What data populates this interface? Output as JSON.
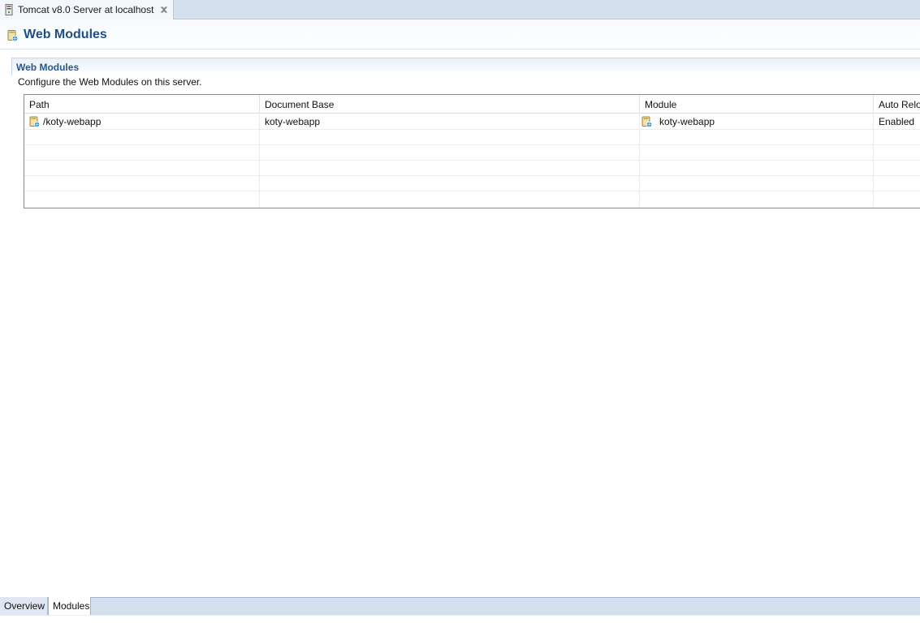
{
  "editor_tab": {
    "label": "Tomcat v8.0 Server at localhost",
    "icon": "server-icon",
    "close_icon": "close-icon"
  },
  "header": {
    "title": "Web Modules",
    "icon": "web-module-icon"
  },
  "section": {
    "title": "Web Modules",
    "description": "Configure the Web Modules on this server."
  },
  "table": {
    "columns": [
      "Path",
      "Document Base",
      "Module",
      "Auto Relo"
    ],
    "rows": [
      {
        "path": "/koty-webapp",
        "document_base": "koty-webapp",
        "module": "koty-webapp",
        "auto_reload": "Enabled"
      }
    ]
  },
  "page_tabs": [
    {
      "label": "Overview",
      "active": false
    },
    {
      "label": "Modules",
      "active": true
    }
  ],
  "colors": {
    "accent_title": "#1f4f85",
    "tab_strip": "#d4e0ee"
  }
}
